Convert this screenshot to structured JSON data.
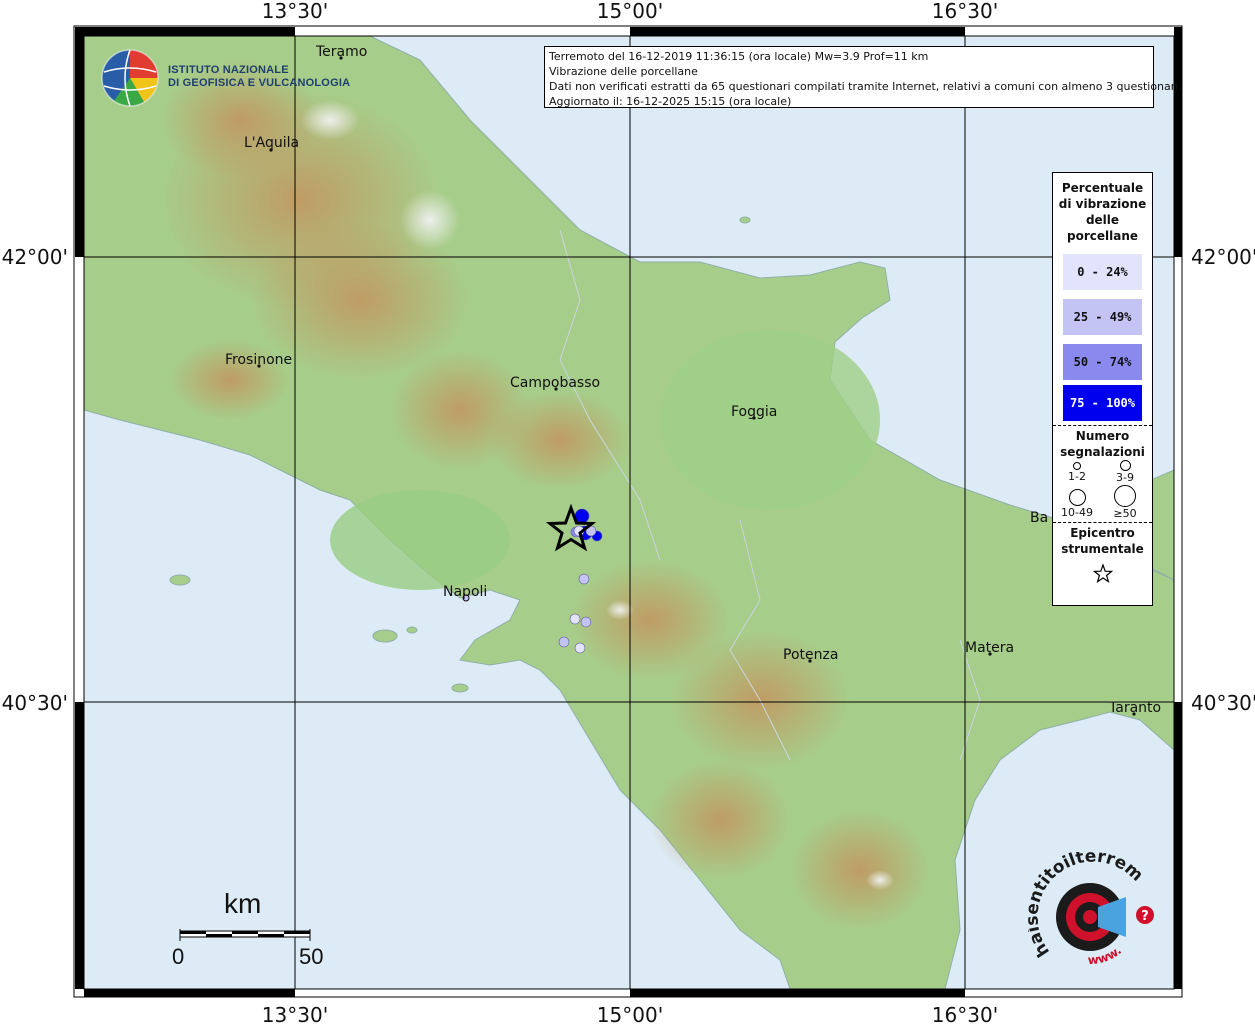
{
  "grid": {
    "top_labels": [
      "13°30'",
      "15°00'",
      "16°30'"
    ],
    "bottom_labels": [
      "13°30'",
      "15°00'",
      "16°30'"
    ],
    "left_labels": [
      "42°00'",
      "40°30'"
    ],
    "right_labels": [
      "42°00'",
      "40°30'"
    ]
  },
  "cities": [
    {
      "name": "Teramo"
    },
    {
      "name": "L'Aquila"
    },
    {
      "name": "Frosinone"
    },
    {
      "name": "Campobasso"
    },
    {
      "name": "Foggia"
    },
    {
      "name": "Ba"
    },
    {
      "name": "Napoli"
    },
    {
      "name": "Potenza"
    },
    {
      "name": "Matera"
    },
    {
      "name": "Taranto"
    }
  ],
  "info": {
    "line1": "Terremoto del 16-12-2019 11:36:15 (ora locale) Mw=3.9 Prof=11 km",
    "line2": "Vibrazione delle porcellane",
    "line3": "Dati non verificati estratti da 65 questionari compilati tramite Internet, relativi a comuni con almeno 3 questionari.",
    "line4": "Aggiornato il: 16-12-2025 15:15 (ora locale)"
  },
  "logo": {
    "ingv_line1": "ISTITUTO NAZIONALE",
    "ingv_line2": "DI GEOFISICA E VULCANOLOGIA",
    "hs_text": "haisentitoilterremoto.it",
    "hs_www": "www."
  },
  "legend": {
    "title_lines": [
      "Percentuale",
      "di vibrazione",
      "delle",
      "porcellane"
    ],
    "classes": [
      {
        "label": "0 - 24%",
        "color": "#e3e3fb"
      },
      {
        "label": "25 - 49%",
        "color": "#c4c4f4"
      },
      {
        "label": "50 - 74%",
        "color": "#8a8aee"
      },
      {
        "label": "75 - 100%",
        "color": "#0000ee"
      }
    ],
    "count_title_lines": [
      "Numero",
      "segnalazioni"
    ],
    "count_classes": [
      "1-2",
      "3-9",
      "10-49",
      "≥50"
    ],
    "epicenter_title_lines": [
      "Epicentro",
      "strumentale"
    ]
  },
  "scale_bar": {
    "unit": "km",
    "min": "0",
    "max": "50"
  },
  "points": [
    {
      "lat_class": 3,
      "count_class": 1
    },
    {
      "lat_class": 3,
      "count_class": 1
    },
    {
      "lat_class": 3,
      "count_class": 0
    },
    {
      "lat_class": 2,
      "count_class": 0
    },
    {
      "lat_class": 1,
      "count_class": 0
    },
    {
      "lat_class": 0,
      "count_class": 0
    },
    {
      "lat_class": 1,
      "count_class": 0
    },
    {
      "lat_class": 1,
      "count_class": 0
    },
    {
      "lat_class": 0,
      "count_class": 0
    },
    {
      "lat_class": 0,
      "count_class": 0
    },
    {
      "lat_class": 1,
      "count_class": 0
    }
  ],
  "colors": {
    "sea": "#dcebf5",
    "land_low": "#9cc982",
    "land_mid": "#d9c98a",
    "land_high": "#b98c56",
    "frame": "#000000"
  }
}
